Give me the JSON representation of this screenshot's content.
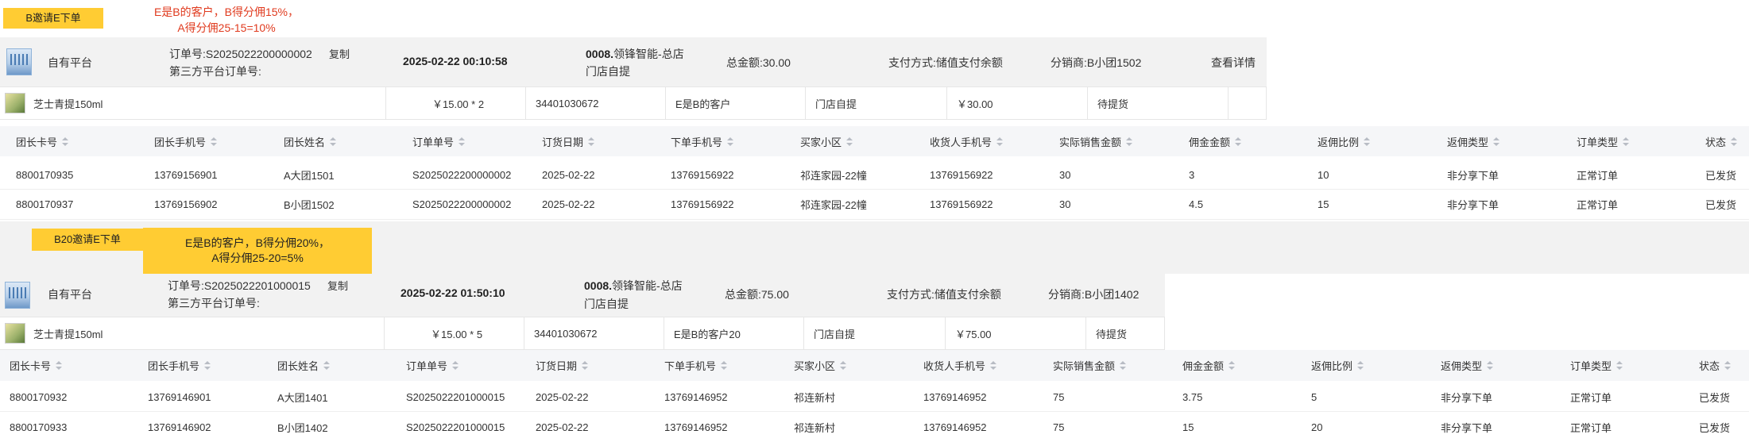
{
  "top_note": {
    "sticky": "B邀请E下单",
    "text": [
      "E是B的客户，B得分佣15%，",
      "A得分佣25-15=10%"
    ]
  },
  "order1": {
    "platform": "自有平台",
    "order_no": "订单号:S2025022200000002",
    "copy": "复制",
    "third_party": "第三方平台订单号:",
    "time": "2025-02-22 00:10:58",
    "store_code": "0008.",
    "store_name": "领锋智能-总店",
    "pickup": "门店自提",
    "total": "总金额:30.00",
    "payment": "支付方式:储值支付余额",
    "distributor": "分销商:B小团1502",
    "detail_link": "查看详情",
    "product": {
      "name": "芝士青提150ml",
      "price": "￥15.00 * 2",
      "code": "34401030672",
      "customer": "E是B的客户",
      "delivery": "门店自提",
      "amount": "￥30.00",
      "status": "待提货"
    }
  },
  "grid_headers": [
    "团长卡号",
    "团长手机号",
    "团长姓名",
    "订单单号",
    "订货日期",
    "下单手机号",
    "买家小区",
    "收货人手机号",
    "实际销售金额",
    "佣金金额",
    "返佣比例",
    "返佣类型",
    "订单类型",
    "状态"
  ],
  "grid1_rows": [
    [
      "8800170935",
      "13769156901",
      "A大团1501",
      "S2025022200000002",
      "2025-02-22",
      "13769156922",
      "祁连家园-22幢",
      "13769156922",
      "30",
      "3",
      "10",
      "非分享下单",
      "正常订单",
      "已发货"
    ],
    [
      "8800170937",
      "13769156902",
      "B小团1502",
      "S2025022200000002",
      "2025-02-22",
      "13769156922",
      "祁连家园-22幢",
      "13769156922",
      "30",
      "4.5",
      "15",
      "非分享下单",
      "正常订单",
      "已发货"
    ]
  ],
  "mid_note": {
    "sticky": "B20邀请E下单",
    "text": [
      "E是B的客户，B得分佣20%，",
      "A得分佣25-20=5%"
    ]
  },
  "order2": {
    "platform": "自有平台",
    "order_no": "订单号:S2025022201000015",
    "copy": "复制",
    "third_party": "第三方平台订单号:",
    "time": "2025-02-22 01:50:10",
    "store_code": "0008.",
    "store_name": "领锋智能-总店",
    "pickup": "门店自提",
    "total": "总金额:75.00",
    "payment": "支付方式:储值支付余额",
    "distributor": "分销商:B小团1402",
    "product": {
      "name": "芝士青提150ml",
      "price": "￥15.00 * 5",
      "code": "34401030672",
      "customer": "E是B的客户20",
      "delivery": "门店自提",
      "amount": "￥75.00",
      "status": "待提货"
    }
  },
  "grid2_rows": [
    [
      "8800170932",
      "13769146901",
      "A大团1401",
      "S2025022201000015",
      "2025-02-22",
      "13769146952",
      "祁连新村",
      "13769146952",
      "75",
      "3.75",
      "5",
      "非分享下单",
      "正常订单",
      "已发货"
    ],
    [
      "8800170933",
      "13769146902",
      "B小团1402",
      "S2025022201000015",
      "2025-02-22",
      "13769146952",
      "祁连新村",
      "13769146952",
      "75",
      "15",
      "20",
      "非分享下单",
      "正常订单",
      "已发货"
    ]
  ],
  "colors": {
    "sticky": "#ffcc33",
    "note_red": "#e03a1e",
    "link": "#3a8ee6",
    "header_bg": "#f2f2f2",
    "grid_head_bg": "#f5f6f8"
  }
}
